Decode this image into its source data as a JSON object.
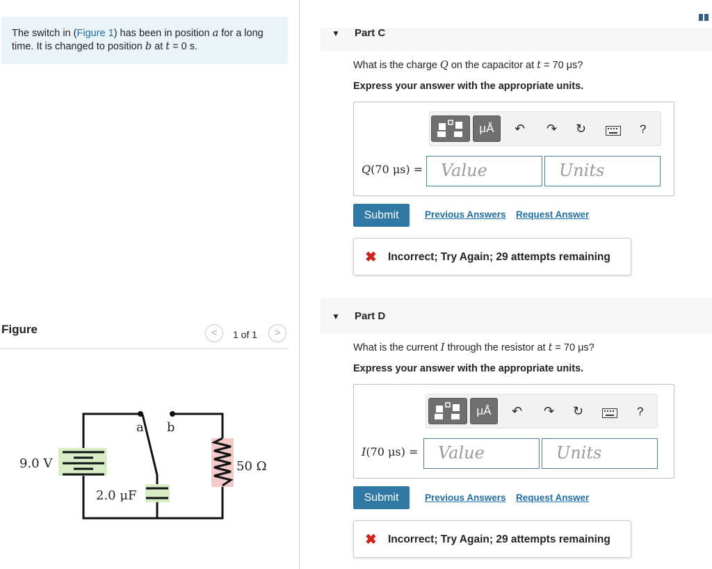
{
  "intro": {
    "text_pre": "The switch in (",
    "link": "Figure 1",
    "text_mid": ") has been in position ",
    "pos_a": "a",
    "text_mid2": " for a long time. It is changed to position ",
    "pos_b": "b",
    "text_at": " at ",
    "t_var": "t",
    "text_end": " = 0 s."
  },
  "figure": {
    "title": "Figure",
    "pager": "1 of 1",
    "prev": "<",
    "next": ">",
    "labels": {
      "voltage": "9.0 V",
      "capacitance": "2.0 μF",
      "resistance": "50 Ω",
      "switch_a": "a",
      "switch_b": "b"
    }
  },
  "parts": [
    {
      "label": "Part C",
      "question_pre": "What is the charge ",
      "question_var": "Q",
      "question_mid": " on the capacitor at ",
      "question_t": "t",
      "question_end": " = 70 μs?",
      "instruction": "Express your answer with the appropriate units.",
      "answer_label_var": "Q",
      "answer_label_rest": "(70 μs) =",
      "value_placeholder": "Value",
      "units_placeholder": "Units",
      "submit": "Submit",
      "previous_answers": "Previous Answers",
      "request_answer": "Request Answer",
      "feedback_icon": "✖",
      "feedback": "Incorrect; Try Again; 29 attempts remaining"
    },
    {
      "label": "Part D",
      "question_pre": "What is the current ",
      "question_var": "I",
      "question_mid": " through the resistor at ",
      "question_t": "t",
      "question_end": " = 70 μs?",
      "instruction": "Express your answer with the appropriate units.",
      "answer_label_var": "I",
      "answer_label_rest": "(70 μs) =",
      "value_placeholder": "Value",
      "units_placeholder": "Units",
      "submit": "Submit",
      "previous_answers": "Previous Answers",
      "request_answer": "Request Answer",
      "feedback_icon": "✖",
      "feedback": "Incorrect; Try Again; 29 attempts remaining"
    }
  ],
  "toolbar": {
    "units_btn": "μÅ",
    "help": "?",
    "icons": [
      "templates-icon",
      "units-icon",
      "undo-icon",
      "redo-icon",
      "reset-icon",
      "keyboard-icon",
      "help-icon"
    ]
  },
  "colors": {
    "accent": "#2f79a4",
    "link": "#1f6fa6",
    "error": "#d0231d",
    "battery_fill": "#d8ecc6",
    "resistor_fill": "#f3c9c9"
  }
}
